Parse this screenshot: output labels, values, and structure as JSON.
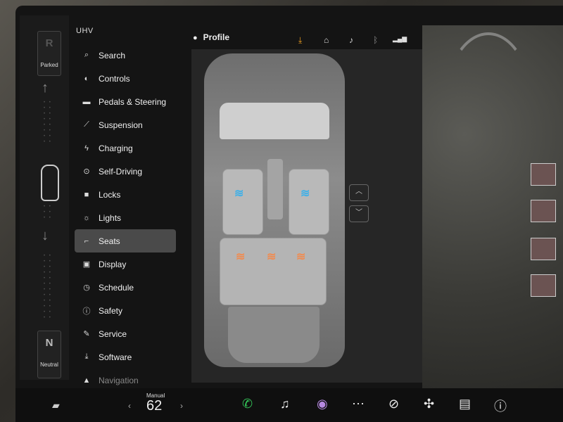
{
  "gear": {
    "top_letter": "R",
    "top_label": "Parked",
    "bottom_letter": "N",
    "bottom_label": "Neutral"
  },
  "brand": "UHV",
  "header": {
    "profile_label": "Profile"
  },
  "menu": {
    "items": [
      {
        "icon": "search-icon",
        "label": "Search"
      },
      {
        "icon": "toggle-icon",
        "label": "Controls"
      },
      {
        "icon": "car-icon",
        "label": "Pedals & Steering"
      },
      {
        "icon": "suspension-icon",
        "label": "Suspension"
      },
      {
        "icon": "bolt-icon",
        "label": "Charging"
      },
      {
        "icon": "steering-wheel-icon",
        "label": "Self-Driving"
      },
      {
        "icon": "lock-icon",
        "label": "Locks"
      },
      {
        "icon": "sun-icon",
        "label": "Lights"
      },
      {
        "icon": "seat-icon",
        "label": "Seats",
        "selected": true
      },
      {
        "icon": "display-icon",
        "label": "Display"
      },
      {
        "icon": "clock-icon",
        "label": "Schedule"
      },
      {
        "icon": "alert-icon",
        "label": "Safety"
      },
      {
        "icon": "wrench-icon",
        "label": "Service"
      },
      {
        "icon": "download-icon",
        "label": "Software"
      },
      {
        "icon": "navigation-icon",
        "label": "Navigation"
      }
    ]
  },
  "bottom_bar": {
    "temp_mode": "Manual",
    "temp_value": "62"
  },
  "colors": {
    "selected": "#4a4a4a",
    "heat_cool": "#3fb0e8",
    "heat_warm": "#ef8c52",
    "download_accent": "#f0a020",
    "phone": "#34c759"
  }
}
